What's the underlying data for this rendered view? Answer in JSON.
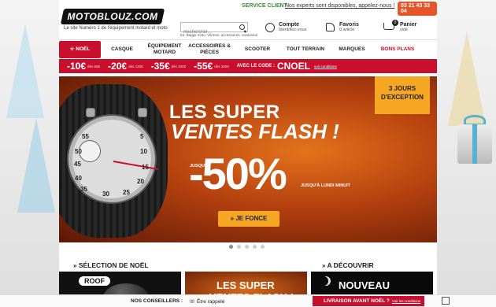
{
  "topbar": {
    "service": "SERVICE CLIENT",
    "experts": "Nos experts sont disponibles, appelez-nous !",
    "phone": "03 21 43 33 04"
  },
  "brand": {
    "logo": "MOTOBLOUZ.COM",
    "tagline": "Le site Numéro 1 de l'équipement motard et moto"
  },
  "search": {
    "placeholder": "Rechercher...",
    "hint": "Ex: Baggs moto, Vitrines, accessoires, vavasseur"
  },
  "header": {
    "account_title": "Compte",
    "account_sub": "Identifiez-vous",
    "favs_title": "Favoris",
    "favs_sub": "0 article",
    "cart_title": "Panier",
    "cart_sub": "vide",
    "cart_count": "0"
  },
  "nav": {
    "items": [
      "☆ NOËL",
      "CASQUE",
      "ÉQUIPEMENT MOTARD",
      "ACCESSOIRES & PIÈCES",
      "SCOOTER",
      "TOUT TERRAIN",
      "MARQUES",
      "BONS PLANS"
    ]
  },
  "promo": {
    "tiers": [
      {
        "amount": "-10€",
        "sub": "dès 60€"
      },
      {
        "amount": "-20€",
        "sub": "dès 120€"
      },
      {
        "amount": "-35€",
        "sub": "dès 200€"
      },
      {
        "amount": "-55€",
        "sub": "dès 300€"
      }
    ],
    "code_label": "AVEC LE CODE :",
    "code": "CNOEL",
    "conditions": "voir conditions"
  },
  "banner": {
    "line1": "LES SUPER",
    "line2": "VENTES FLASH !",
    "upto": "JUSQU'À",
    "percent": "-50%",
    "until": "JUSQU'À LUNDI MINUIT",
    "badge_line1": "3 JOURS",
    "badge_line2": "D'EXCEPTION",
    "cta": "» JE FONCE",
    "dial_numbers": [
      "55",
      "5",
      "50",
      "10",
      "45",
      "15",
      "40",
      "20",
      "35",
      "25",
      "30"
    ]
  },
  "carousel": {
    "count": 5,
    "active": 0
  },
  "sections": {
    "left": "SÉLECTION DE NOËL",
    "right": "A DÉCOUVRIR",
    "thumb1": "ROOF",
    "thumb2_line1": "LES SUPER",
    "thumb2_line2": "VENTES FLASH !",
    "thumb3": "NOUVEAU"
  },
  "bottom": {
    "advisors": "NOS CONSEILLERS :",
    "chat": "Être rappelé",
    "delivery": "LIVRAISON AVANT NOËL ?",
    "delivery_link": "Voir les conditions"
  },
  "colors": {
    "red": "#c8102e",
    "orange": "#f5a623",
    "green": "#3d8f3d",
    "phone_bg": "#e8552a"
  }
}
